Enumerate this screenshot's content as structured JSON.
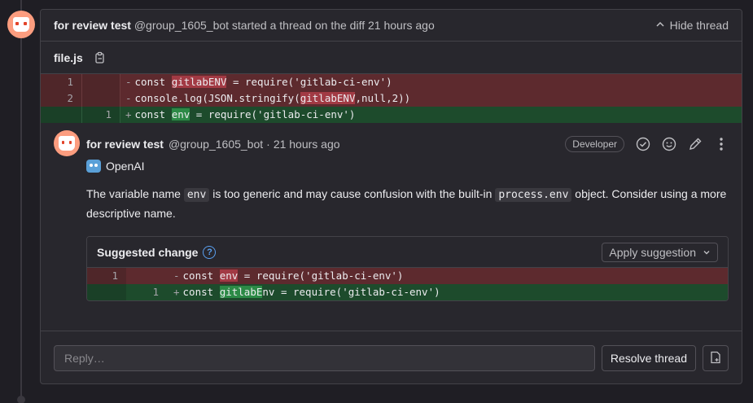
{
  "thread": {
    "author": "for review test",
    "handle": "@group_1605_bot",
    "action": "started a thread on the diff",
    "time": "21 hours ago",
    "hide_label": "Hide thread"
  },
  "file": {
    "name": "file.js",
    "copy_icon": "copy-icon"
  },
  "diff": [
    {
      "type": "old",
      "old": "1",
      "new": "",
      "sign": "-",
      "pre": "const ",
      "hl": "gitlabENV",
      "post": " = require('gitlab-ci-env')"
    },
    {
      "type": "old",
      "old": "2",
      "new": "",
      "sign": "-",
      "pre": "console.log(JSON.stringify(",
      "hl": "gitlabENV",
      "post": ",null,2))"
    },
    {
      "type": "new",
      "old": "",
      "new": "1",
      "sign": "+",
      "pre": "const ",
      "hl": "env",
      "post": " = require('gitlab-ci-env')"
    }
  ],
  "note": {
    "author": "for review test",
    "handle": "@group_1605_bot",
    "separator": "·",
    "time": "21 hours ago",
    "role_badge": "Developer",
    "bot_label": "OpenAI",
    "text_1": "The variable name ",
    "code_1": "env",
    "text_2": " is too generic and may cause confusion with the built-in ",
    "code_2": "process.env",
    "text_3": " object. Consider using a more descriptive name."
  },
  "suggestion": {
    "title": "Suggested change",
    "apply_label": "Apply suggestion",
    "rows": [
      {
        "type": "old",
        "old": "1",
        "new": "",
        "sign": "-",
        "pre": "const ",
        "hl": "env",
        "post": " = require('gitlab-ci-env')"
      },
      {
        "type": "new",
        "old": "",
        "new": "1",
        "sign": "+",
        "pre": "const ",
        "hl": "gitlabE",
        "post": "nv = require('gitlab-ci-env')"
      }
    ]
  },
  "reply": {
    "placeholder": "Reply…",
    "resolve_label": "Resolve thread"
  },
  "colors": {
    "background": "#1f1e24",
    "removed": "#5d2a2e",
    "added": "#1d4b2c",
    "accent_avatar": "#fc9d7f",
    "link_blue": "#5aa0f0"
  }
}
